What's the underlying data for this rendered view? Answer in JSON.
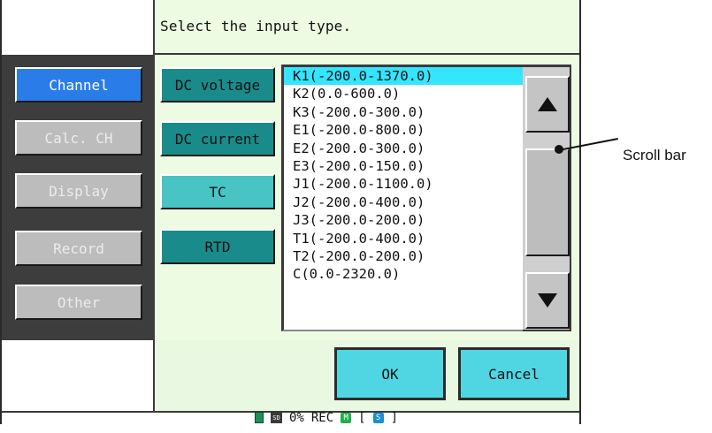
{
  "title": "Select the input type.",
  "nav": [
    {
      "label": "Channel",
      "active": true
    },
    {
      "label": "Calc. CH",
      "active": false
    },
    {
      "label": "Display",
      "active": false
    },
    {
      "label": "Record",
      "active": false
    },
    {
      "label": "Other",
      "active": false
    }
  ],
  "input_types": [
    {
      "label": "DC voltage",
      "selected": false
    },
    {
      "label": "DC current",
      "selected": false
    },
    {
      "label": "TC",
      "selected": true
    },
    {
      "label": "RTD",
      "selected": false
    }
  ],
  "tc_list": [
    "K1(-200.0-1370.0)",
    "K2(0.0-600.0)",
    "K3(-200.0-300.0)",
    "E1(-200.0-800.0)",
    "E2(-200.0-300.0)",
    "E3(-200.0-150.0)",
    "J1(-200.0-1100.0)",
    "J2(-200.0-400.0)",
    "J3(-200.0-200.0)",
    "T1(-200.0-400.0)",
    "T2(-200.0-200.0)",
    "C(0.0-2320.0)"
  ],
  "selected_index": 0,
  "scroll": {
    "up_icon": "up-triangle",
    "down_icon": "down-triangle"
  },
  "buttons": {
    "ok": "OK",
    "cancel": "Cancel"
  },
  "status": {
    "percent": "0%",
    "rec": "REC",
    "m_icon": "M",
    "s_icon": "S",
    "bracket_open": "[",
    "bracket_close": "]"
  },
  "annotation": {
    "label": "Scroll bar"
  },
  "colors": {
    "active_nav": "#2a7de8",
    "selected_type": "#48c4c4",
    "type_button": "#1a8b8b",
    "list_selection": "#33e5ff",
    "action_button": "#4fd6e2",
    "background": "#edfbe3"
  }
}
